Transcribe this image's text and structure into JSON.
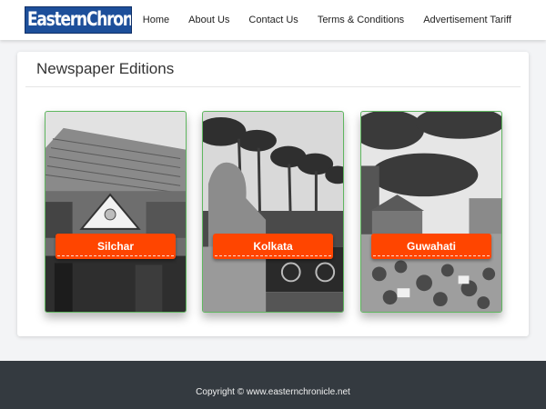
{
  "header": {
    "logo_text": "EasternChronicle",
    "nav": [
      "Home",
      "About Us",
      "Contact Us",
      "Terms & Conditions",
      "Advertisement Tariff"
    ]
  },
  "main": {
    "title": "Newspaper Editions",
    "editions": [
      {
        "label": "Silchar"
      },
      {
        "label": "Kolkata"
      },
      {
        "label": "Guwahati"
      }
    ]
  },
  "footer": {
    "copyright": "Copyright © www.easternchronicle.net"
  },
  "colors": {
    "button": "#ff4500",
    "card_border": "#5fb75f",
    "footer": "#343a40",
    "logo": "#1d4f9a"
  }
}
